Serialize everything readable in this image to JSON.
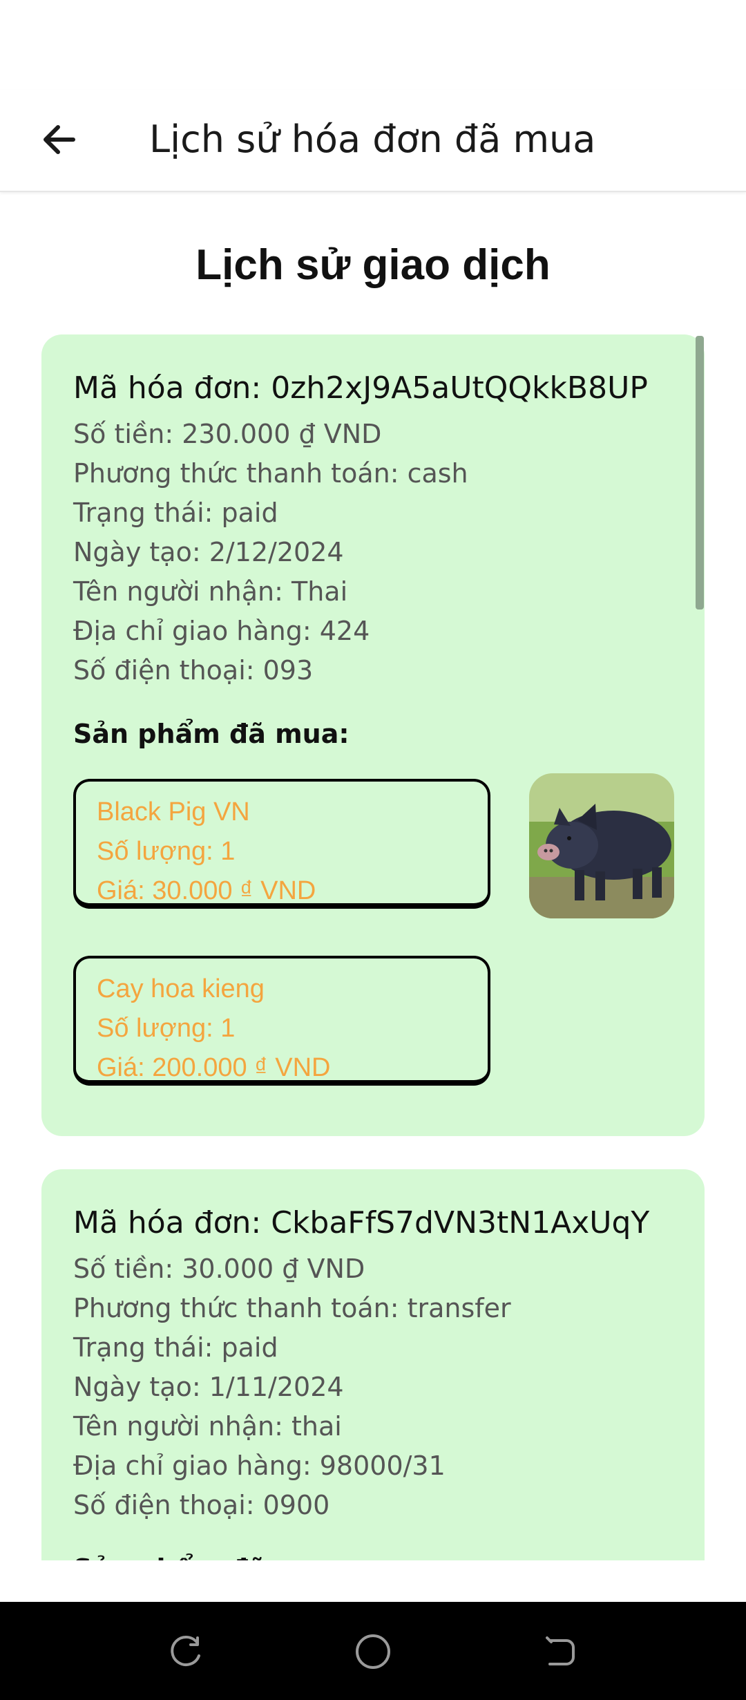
{
  "appbar": {
    "title": "Lịch sử hóa đơn đã mua",
    "back_icon": "arrow-left-icon"
  },
  "page": {
    "heading": "Lịch sử giao dịch"
  },
  "invoices": [
    {
      "id_line": "Mã hóa đơn: 0zh2xJ9A5aUtQQkkB8UP",
      "amount": "Số tiền: 230.000 ₫ VND",
      "payment": "Phương thức thanh toán: cash",
      "status": "Trạng thái: paid",
      "date": "Ngày tạo: 2/12/2024",
      "recipient": "Tên người nhận: Thai",
      "address": "Địa chỉ giao hàng: 424",
      "phone": "Số điện thoại: 093",
      "products_title": "Sản phẩm đã mua:",
      "products": [
        {
          "name": "Black Pig VN",
          "qty": "Số lượng: 1",
          "price": "Giá: 30.000 ₫ VND",
          "image": "black-pig-photo"
        },
        {
          "name": "Cay hoa kieng",
          "qty": "Số lượng: 1",
          "price": "Giá: 200.000 ₫ VND"
        }
      ]
    },
    {
      "id_line": "Mã hóa đơn: CkbaFfS7dVN3tN1AxUqY",
      "amount": "Số tiền: 30.000 ₫ VND",
      "payment": "Phương thức thanh toán: transfer",
      "status": "Trạng thái: paid",
      "date": "Ngày tạo: 1/11/2024",
      "recipient": "Tên người nhận: thai",
      "address": "Địa chỉ giao hàng: 98000/31",
      "phone": "Số điện thoại: 0900",
      "products_title": "Sản phẩm đã mua:"
    }
  ],
  "colors": {
    "card_bg": "#d5f9d4",
    "product_text": "#f4a53f",
    "navbar_bg": "#000000"
  },
  "navbar": {
    "icons": [
      "recent-apps-icon",
      "home-icon",
      "back-icon"
    ]
  }
}
